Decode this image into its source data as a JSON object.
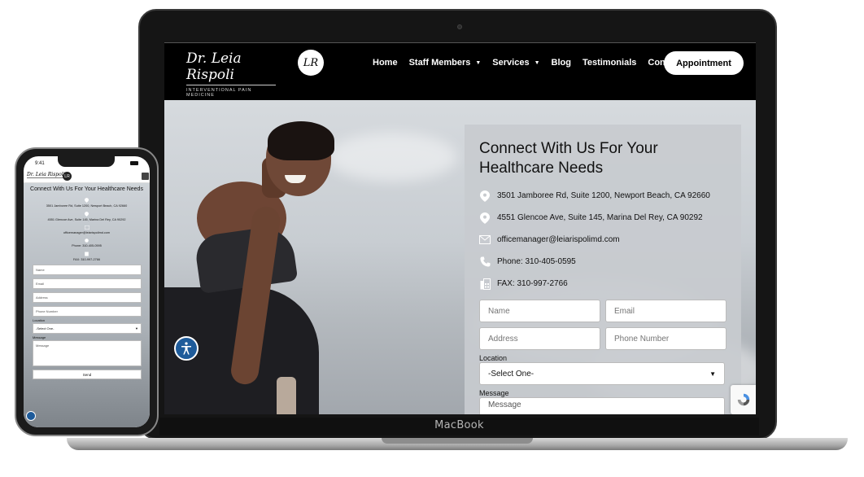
{
  "laptop": {
    "brand_label": "MacBook"
  },
  "site": {
    "logo_name": "Dr. Leia Rispoli",
    "logo_tagline": "INTERVENTIONAL PAIN MEDICINE",
    "logo_mark": "LR",
    "nav": [
      {
        "label": "Home",
        "has_dropdown": false
      },
      {
        "label": "Staff Members",
        "has_dropdown": true
      },
      {
        "label": "Services",
        "has_dropdown": true
      },
      {
        "label": "Blog",
        "has_dropdown": false
      },
      {
        "label": "Testimonials",
        "has_dropdown": false
      },
      {
        "label": "Contact",
        "has_dropdown": false
      }
    ],
    "appointment_button": "Appointment"
  },
  "contact": {
    "title": "Connect With Us For Your Healthcare Needs",
    "address_1": "3501 Jamboree Rd, Suite 1200, Newport Beach, CA 92660",
    "address_2": "4551 Glencoe Ave, Suite 145, Marina Del Rey, CA 90292",
    "email": "officemanager@leiarispolimd.com",
    "phone": "Phone: 310-405-0595",
    "fax": "FAX: 310-997-2766"
  },
  "form": {
    "name_placeholder": "Name",
    "email_placeholder": "Email",
    "address_placeholder": "Address",
    "phone_placeholder": "Phone Number",
    "location_label": "Location",
    "location_selected": "-Select One-",
    "message_label": "Message",
    "message_placeholder": "Message",
    "send_label": "Send"
  },
  "phone": {
    "status_time": "9:41",
    "address_1": "3501 Jamboree Rd, Suite 1200, Newport Beach, CA 92660",
    "address_2": "4551 Glencoe Ave, Suite 145, Marina Del Rey, CA 90292",
    "email": "officemanager@leiarispolimd.com",
    "phone": "Phone: 310-405-0595",
    "fax": "FAX: 310-997-2766",
    "title": "Connect With Us For Your Healthcare Needs",
    "logo_name": "Dr. Leia Rispoli",
    "logo_mark": "LR"
  },
  "colors": {
    "header_bg": "#000000",
    "card_bg": "#c8cbcf",
    "accessibility_blue": "#1e5b9a"
  },
  "icons": [
    "location-pin-icon",
    "email-icon",
    "phone-icon",
    "fax-icon",
    "accessibility-icon",
    "chevron-down-icon",
    "recaptcha-icon",
    "hamburger-menu-icon"
  ]
}
